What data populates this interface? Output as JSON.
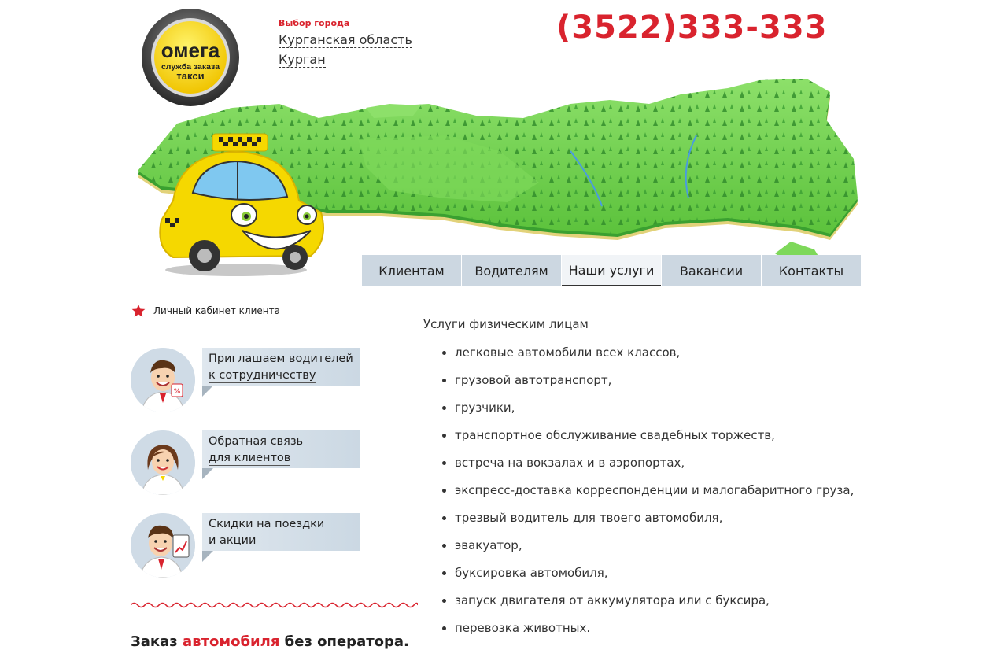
{
  "logo": {
    "line1": "омега",
    "line2": "служба заказа",
    "line3": "такси"
  },
  "city": {
    "caption": "Выбор города",
    "region": "Курганская область",
    "town": "Курган"
  },
  "phone": "(3522)333-333",
  "nav": [
    {
      "label": "Клиентам"
    },
    {
      "label": "Водителям"
    },
    {
      "label": "Наши услуги",
      "active": true
    },
    {
      "label": "Вакансии"
    },
    {
      "label": "Контакты"
    }
  ],
  "cabinet": {
    "label": "Личный кабинет клиента",
    "icon": "star-icon"
  },
  "promos": [
    {
      "line1": "Приглашаем водителей",
      "line2": "к сотрудничеству"
    },
    {
      "line1": "Обратная связь",
      "line2": "для клиентов"
    },
    {
      "line1": "Скидки на поездки",
      "line2": "и акции"
    }
  ],
  "order": {
    "part1": "Заказ",
    "part2": "автомобиля",
    "part3": "без оператора."
  },
  "services": {
    "title": "Услуги физическим лицам",
    "items": [
      "легковые автомобили всех классов,",
      "грузовой автотранспорт,",
      "грузчики,",
      "транспортное обслуживание свадебных торжеств,",
      "встреча на вокзалах и в аэропортах,",
      "экспресс-доставка корреспонденции и малогабаритного груза,",
      "трезвый водитель для твоего автомобиля,",
      "эвакуатор,",
      "буксировка автомобиля,",
      "запуск двигателя от аккумулятора или с буксира,",
      "перевозка животных."
    ]
  },
  "colors": {
    "accent": "#d9232e",
    "nav_bg": "#ccd7e1",
    "map_green": "#6fcf4a",
    "taxi_yellow": "#f5d800"
  }
}
